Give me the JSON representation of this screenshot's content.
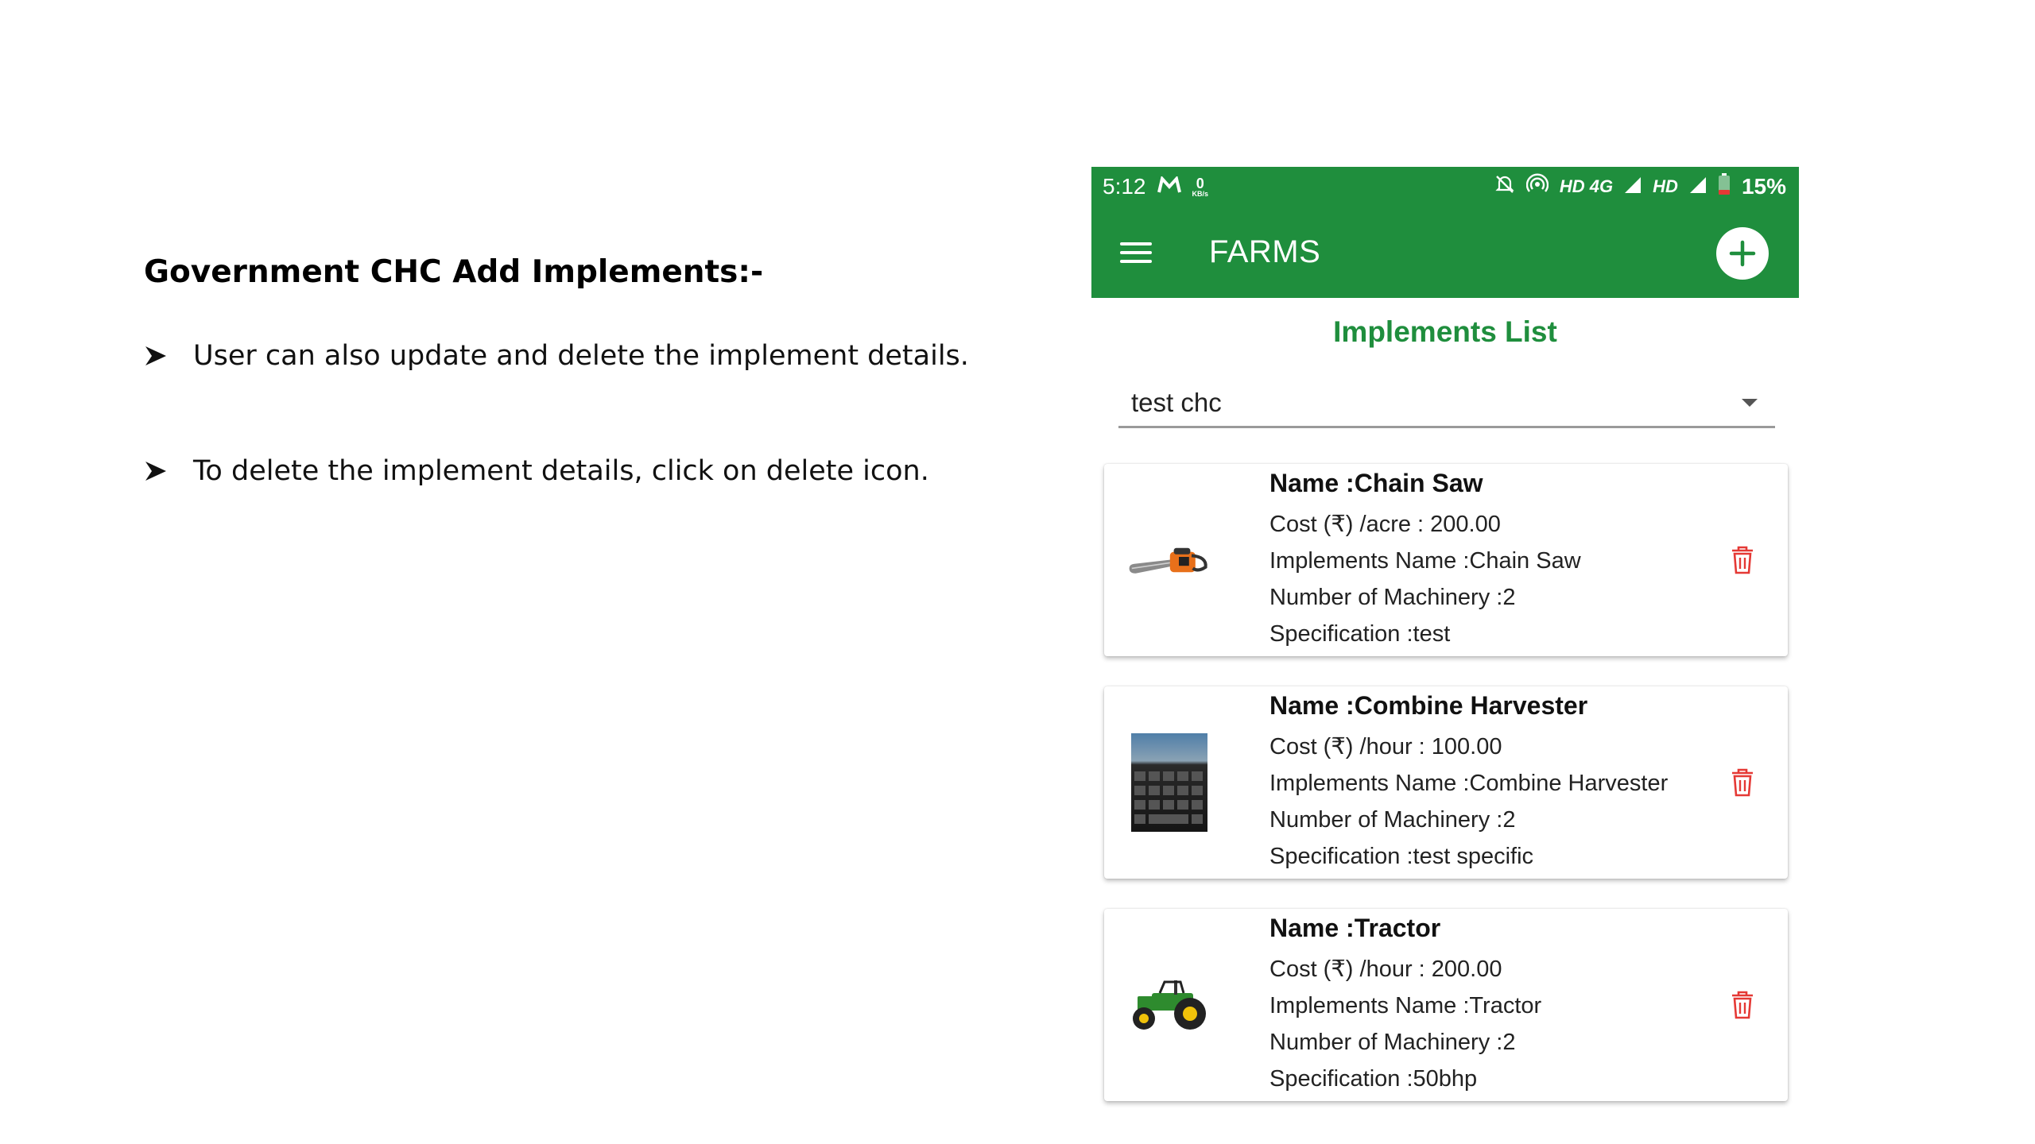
{
  "slide": {
    "title": "Government CHC Add Implements:-",
    "bullets": [
      "User can also update and delete the implement details.",
      "To delete the implement details, click on delete icon."
    ]
  },
  "status_bar": {
    "time": "5:12",
    "data_rate": "0",
    "data_unit": "KB/s",
    "network1": "HD 4G",
    "network2": "HD",
    "battery": "15%"
  },
  "app_bar": {
    "title": "FARMS"
  },
  "list_title": "Implements List",
  "select": {
    "value": "test chc"
  },
  "implements": [
    {
      "name": "Name  :Chain Saw",
      "cost": "Cost (₹) /acre : 200.00",
      "implement_name": "Implements Name  :Chain Saw",
      "machinery": "Number of Machinery :2",
      "specification": "Specification  :test",
      "image": "chainsaw"
    },
    {
      "name": "Name  :Combine Harvester",
      "cost": "Cost (₹) /hour : 100.00",
      "implement_name": "Implements Name  :Combine Harvester",
      "machinery": "Number of Machinery :2",
      "specification": "Specification  :test specific",
      "image": "keyboard-photo"
    },
    {
      "name": "Name  :Tractor",
      "cost": "Cost (₹) /hour : 200.00",
      "implement_name": "Implements Name  :Tractor",
      "machinery": "Number of Machinery :2",
      "specification": "Specification  :50bhp",
      "image": "tractor"
    }
  ],
  "colors": {
    "primary": "#1f8e3d",
    "delete": "#e53935"
  }
}
